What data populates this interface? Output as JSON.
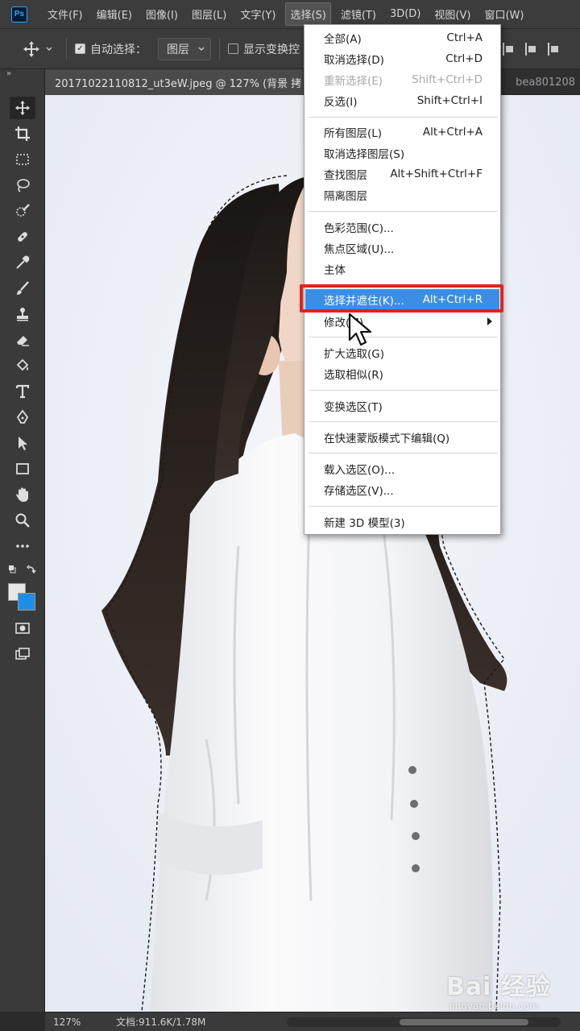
{
  "menubar": {
    "logo": "Ps",
    "items": [
      {
        "label": "文件(F)"
      },
      {
        "label": "编辑(E)"
      },
      {
        "label": "图像(I)"
      },
      {
        "label": "图层(L)"
      },
      {
        "label": "文字(Y)"
      },
      {
        "label": "选择(S)"
      },
      {
        "label": "滤镜(T)"
      },
      {
        "label": "3D(D)"
      },
      {
        "label": "视图(V)"
      },
      {
        "label": "窗口(W)"
      }
    ]
  },
  "optionsbar": {
    "auto_select_label": "自动选择：",
    "auto_select_value": "图层",
    "show_transform_label": "显示变换控"
  },
  "document": {
    "tab_title": "20171022110812_ut3eW.jpeg @ 127% (背景 拷",
    "second_tab": "bea801208"
  },
  "select_menu": {
    "groups": [
      [
        {
          "label": "全部(A)",
          "shortcut": "Ctrl+A"
        },
        {
          "label": "取消选择(D)",
          "shortcut": "Ctrl+D"
        },
        {
          "label": "重新选择(E)",
          "shortcut": "Shift+Ctrl+D",
          "disabled": true
        },
        {
          "label": "反选(I)",
          "shortcut": "Shift+Ctrl+I"
        }
      ],
      [
        {
          "label": "所有图层(L)",
          "shortcut": "Alt+Ctrl+A"
        },
        {
          "label": "取消选择图层(S)",
          "shortcut": ""
        },
        {
          "label": "查找图层",
          "shortcut": "Alt+Shift+Ctrl+F"
        },
        {
          "label": "隔离图层",
          "shortcut": ""
        }
      ],
      [
        {
          "label": "色彩范围(C)...",
          "shortcut": ""
        },
        {
          "label": "焦点区域(U)...",
          "shortcut": ""
        },
        {
          "label": "主体",
          "shortcut": ""
        }
      ],
      [
        {
          "label": "选择并遮住(K)...",
          "shortcut": "Alt+Ctrl+R",
          "highlight": true
        },
        {
          "label": "修改(M)",
          "shortcut": "",
          "submenu": true
        }
      ],
      [
        {
          "label": "扩大选取(G)",
          "shortcut": ""
        },
        {
          "label": "选取相似(R)",
          "shortcut": ""
        }
      ],
      [
        {
          "label": "变换选区(T)",
          "shortcut": ""
        }
      ],
      [
        {
          "label": "在快速蒙版模式下编辑(Q)",
          "shortcut": ""
        }
      ],
      [
        {
          "label": "载入选区(O)...",
          "shortcut": ""
        },
        {
          "label": "存储选区(V)...",
          "shortcut": ""
        }
      ],
      [
        {
          "label": "新建 3D 模型(3)",
          "shortcut": ""
        }
      ]
    ]
  },
  "statusbar": {
    "zoom": "127%",
    "doc_info": "文档:911.6K/1.78M"
  },
  "watermark": {
    "main": "Bai 经验",
    "sub": "jingyan.baidu.com"
  },
  "colors": {
    "foreground": "#e6e6e6",
    "background": "#1e8fe8",
    "highlight": "#3a8ee6",
    "callout": "#e0231c"
  }
}
